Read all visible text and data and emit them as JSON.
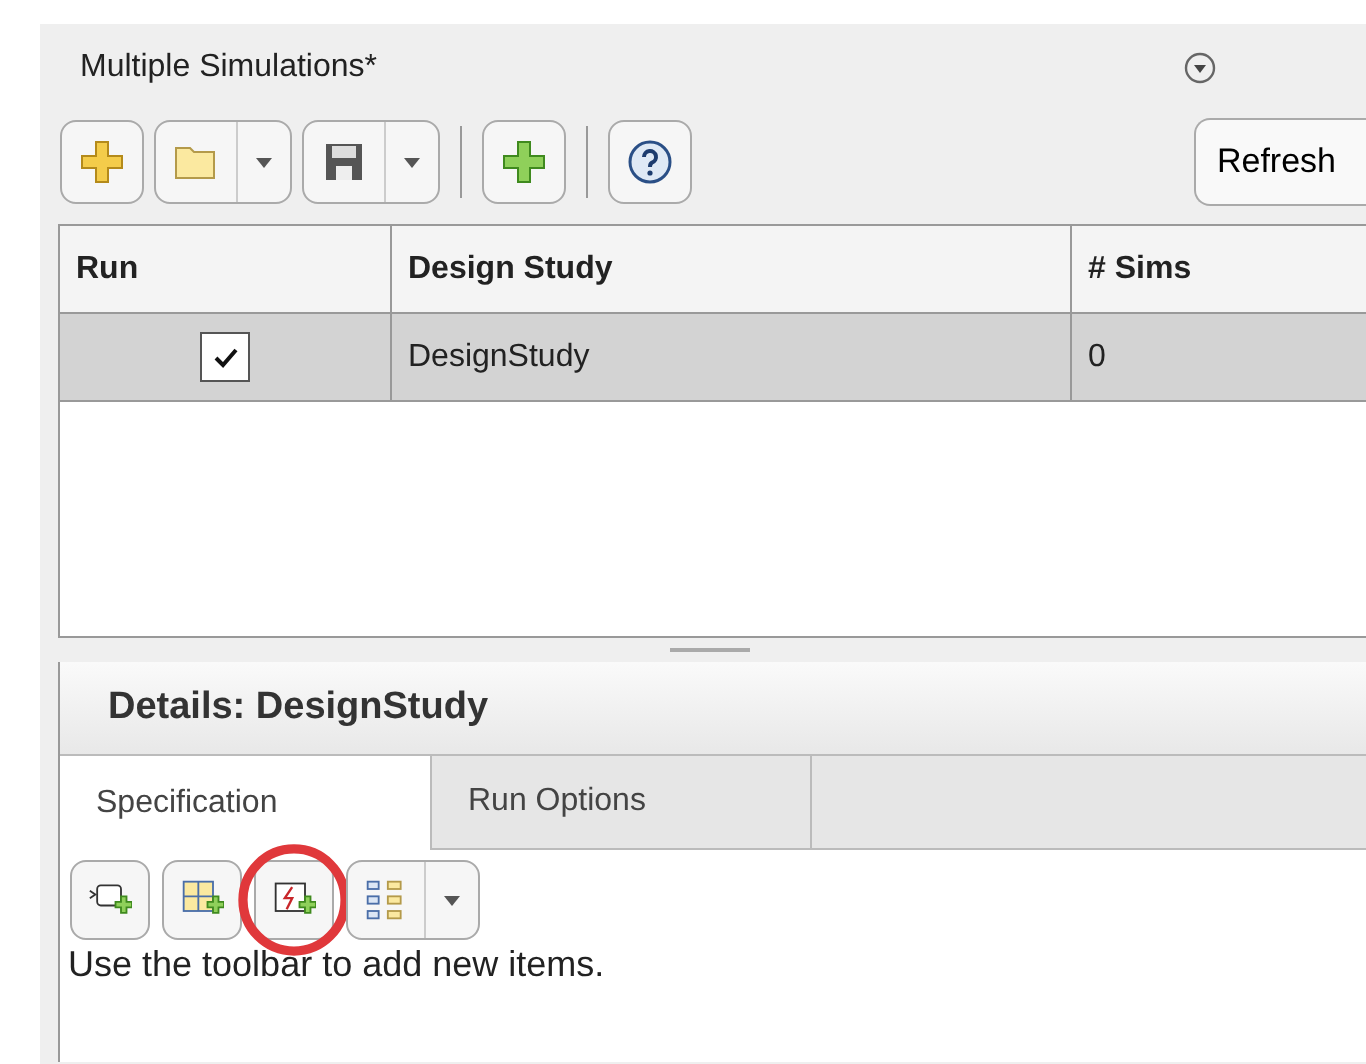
{
  "panel": {
    "title": "Multiple Simulations*"
  },
  "toolbar": {
    "refresh": "Refresh"
  },
  "table": {
    "columns": [
      "Run",
      "Design Study",
      "# Sims"
    ],
    "rows": [
      {
        "run": true,
        "selected": true,
        "design_study": "DesignStudy",
        "sims": "0"
      }
    ]
  },
  "details": {
    "title": "Details: DesignStudy",
    "tabs": [
      {
        "label": "Specification",
        "selected": true
      },
      {
        "label": "Run Options",
        "selected": false
      }
    ],
    "tools": [
      {
        "kind": "block",
        "highlighted": false
      },
      {
        "kind": "grid",
        "highlighted": false
      },
      {
        "kind": "signal",
        "highlighted": true
      },
      {
        "kind": "hierarchy",
        "highlighted": false
      }
    ],
    "message": "Use the toolbar to add new items."
  }
}
